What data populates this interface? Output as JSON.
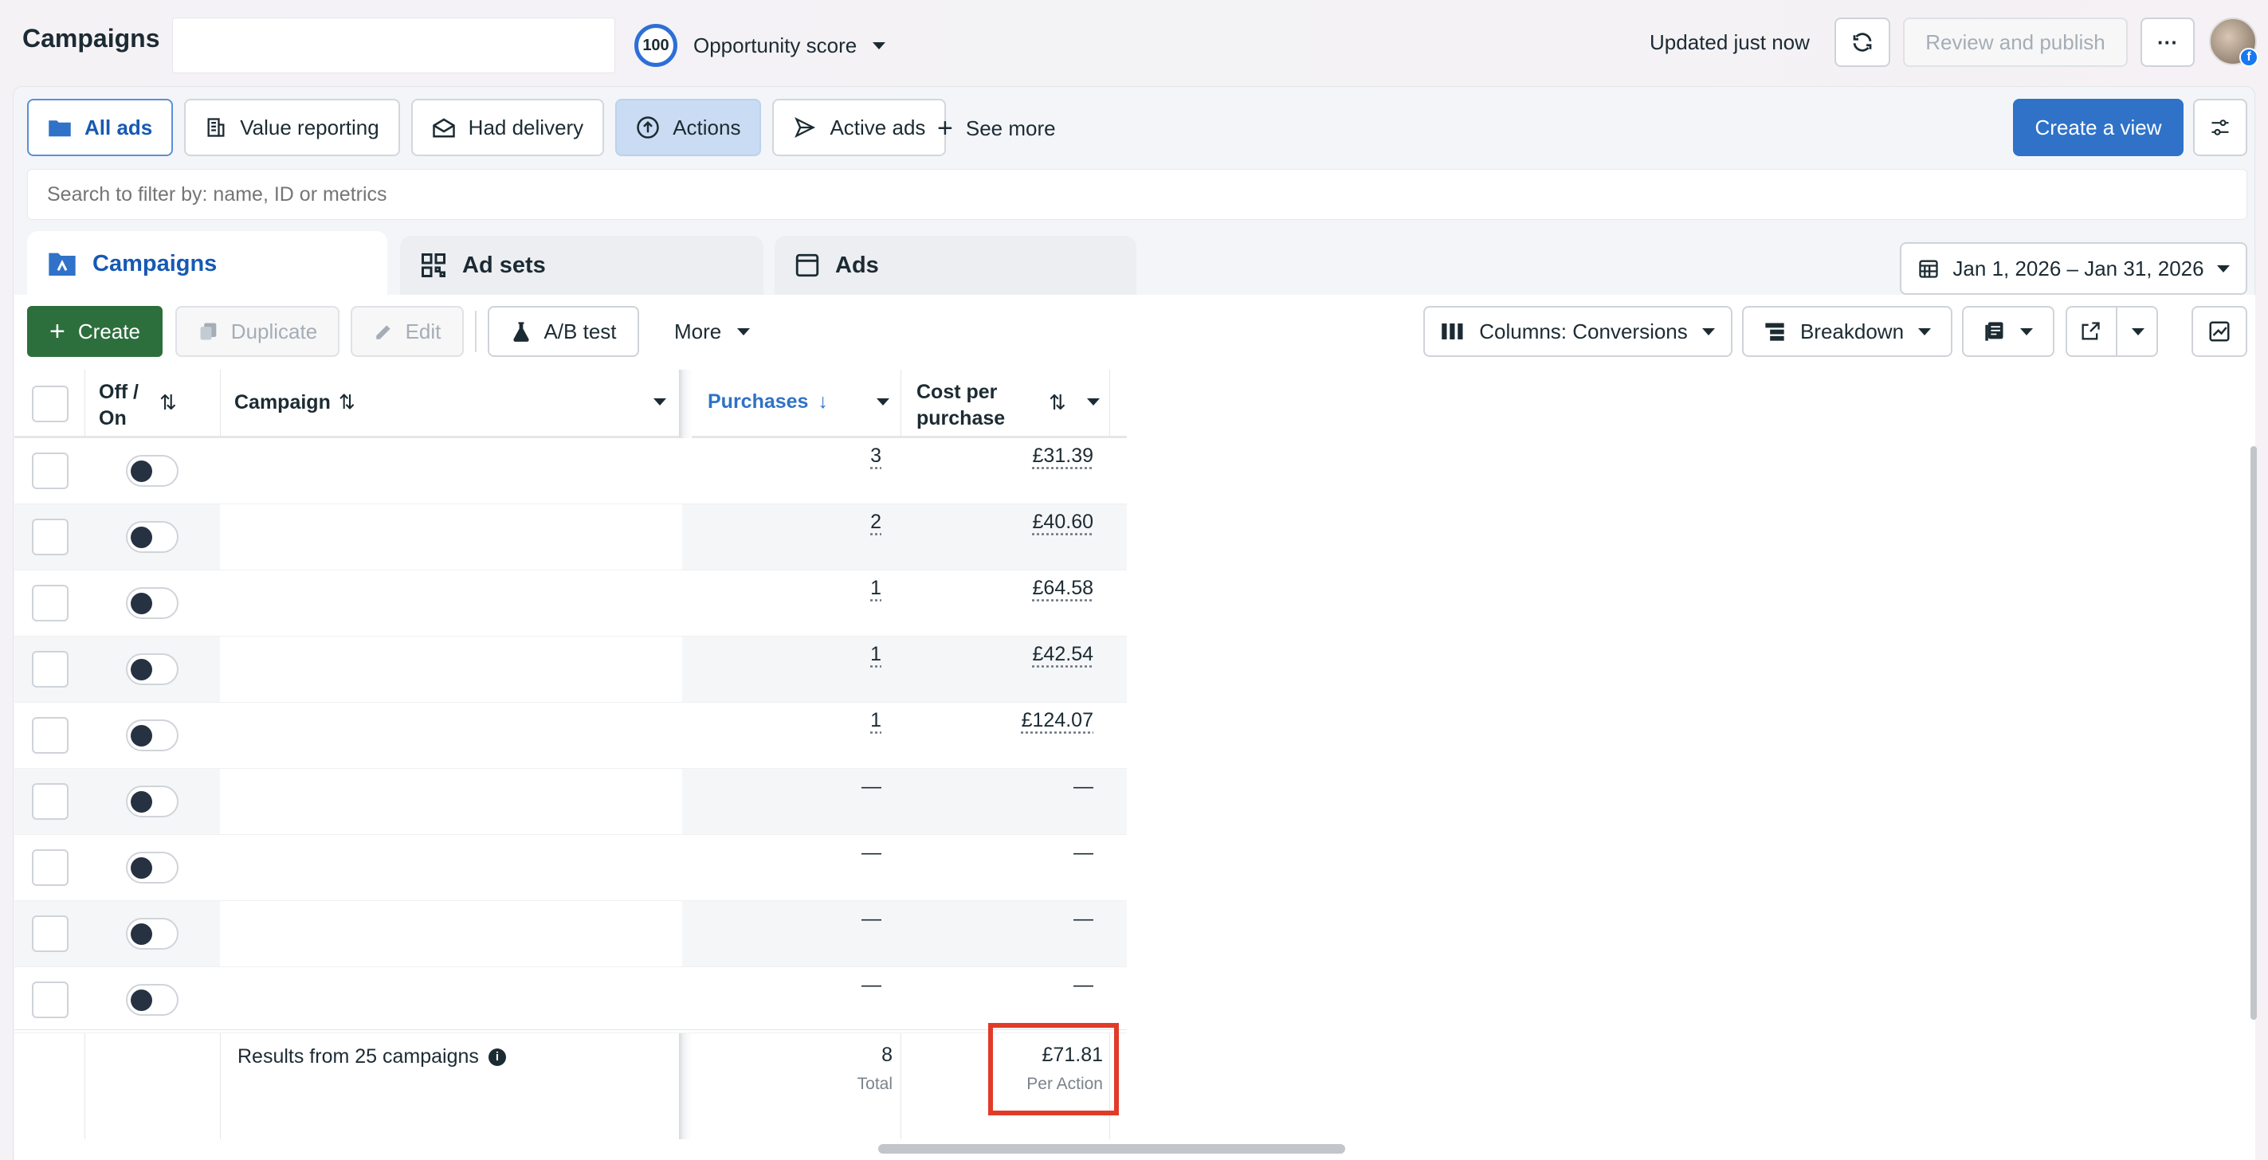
{
  "header": {
    "title": "Campaigns",
    "score_value": "100",
    "score_label": "Opportunity score",
    "updated": "Updated just now",
    "review": "Review and publish",
    "more": "···"
  },
  "views": [
    {
      "label": "All ads",
      "icon": "folder-icon"
    },
    {
      "label": "Value reporting",
      "icon": "building-icon"
    },
    {
      "label": "Had delivery",
      "icon": "envelope-icon"
    },
    {
      "label": "Actions",
      "icon": "arrow-up-circle-icon"
    },
    {
      "label": "Active ads",
      "icon": "paper-plane-icon"
    }
  ],
  "see_more": "See more",
  "create_view": "Create a view",
  "search": {
    "placeholder": "Search to filter by: name, ID or metrics"
  },
  "tabs": [
    {
      "label": "Campaigns"
    },
    {
      "label": "Ad sets"
    },
    {
      "label": "Ads"
    }
  ],
  "date_range": "Jan 1, 2026 – Jan 31, 2026",
  "toolbar": {
    "create": "Create",
    "duplicate": "Duplicate",
    "edit": "Edit",
    "ab_test": "A/B test",
    "more": "More",
    "columns": "Columns: Conversions",
    "breakdown": "Breakdown"
  },
  "table": {
    "headers": {
      "offon": "Off / On",
      "campaign": "Campaign",
      "purchases": "Purchases",
      "cost": "Cost per purchase"
    },
    "rows": [
      {
        "purchases": "3",
        "cost": "£31.39"
      },
      {
        "purchases": "2",
        "cost": "£40.60"
      },
      {
        "purchases": "1",
        "cost": "£64.58"
      },
      {
        "purchases": "1",
        "cost": "£42.54"
      },
      {
        "purchases": "1",
        "cost": "£124.07"
      },
      {
        "purchases": "—",
        "cost": "—"
      },
      {
        "purchases": "—",
        "cost": "—"
      },
      {
        "purchases": "—",
        "cost": "—"
      },
      {
        "purchases": "—",
        "cost": "—"
      }
    ],
    "footer": {
      "results": "Results from 25 campaigns",
      "purchases_total": "8",
      "purchases_label": "Total",
      "cost_total": "£71.81",
      "cost_label": "Per Action"
    }
  },
  "colors": {
    "accent": "#2f72c8",
    "create": "#2d6e3d",
    "highlight": "#e13a29"
  }
}
